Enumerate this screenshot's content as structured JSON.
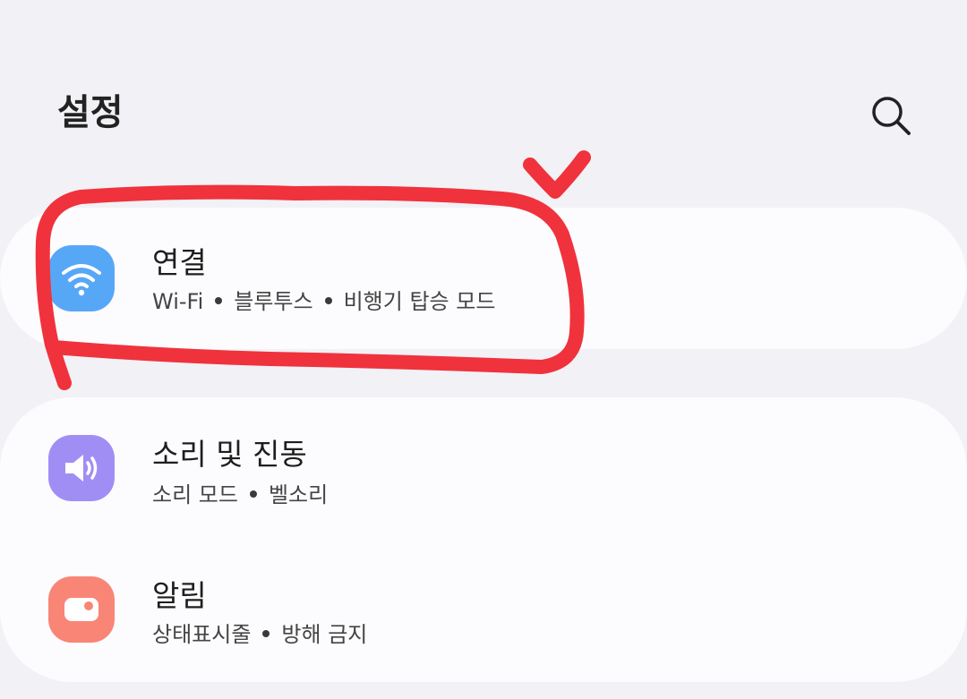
{
  "header": {
    "title": "설정",
    "search_icon": "search-icon"
  },
  "settings": {
    "connections": {
      "title": "연결",
      "subtitle_parts": [
        "Wi-Fi",
        "블루투스",
        "비행기 탑승 모드"
      ],
      "icon": "wifi-icon",
      "icon_color": "#57a7f7"
    },
    "sound": {
      "title": "소리 및 진동",
      "subtitle_parts": [
        "소리 모드",
        "벨소리"
      ],
      "icon": "speaker-icon",
      "icon_color": "#a18ef5"
    },
    "notifications": {
      "title": "알림",
      "subtitle_parts": [
        "상태표시줄",
        "방해 금지"
      ],
      "icon": "notification-icon",
      "icon_color": "#f98576"
    }
  },
  "annotation": {
    "color": "#f0323c",
    "shapes": [
      "circle-marker",
      "check-marker"
    ]
  }
}
